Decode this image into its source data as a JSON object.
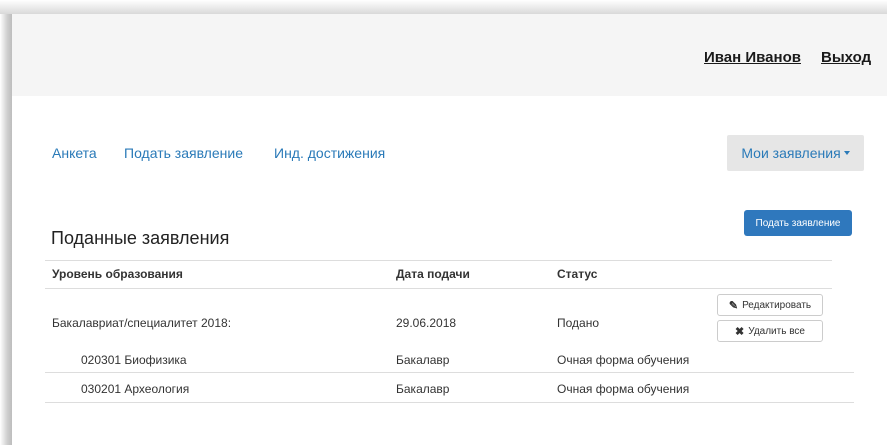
{
  "header": {
    "user_name": "Иван Иванов",
    "logout_label": "Выход"
  },
  "nav": {
    "items": [
      "Анкета",
      "Подать заявление",
      "Инд. достижения"
    ],
    "dropdown_label": "Мои заявления"
  },
  "page": {
    "submit_button": "Подать заявление",
    "section_title": "Поданные заявления"
  },
  "table": {
    "headers": [
      "Уровень образования",
      "Дата подачи",
      "Статус"
    ],
    "group": {
      "level": "Бакалавриат/специалитет 2018:",
      "date": "29.06.2018",
      "status": "Подано",
      "edit_label": "Редактировать",
      "delete_label": "Удалить все"
    },
    "rows": [
      {
        "program": "020301 Биофизика",
        "degree": "Бакалавр",
        "form": "Очная форма обучения"
      },
      {
        "program": "030201 Археология",
        "degree": "Бакалавр",
        "form": "Очная форма обучения"
      }
    ]
  },
  "icons": {
    "edit": "pencil-icon",
    "delete": "x-icon",
    "dropdown": "caret-down-icon"
  },
  "colors": {
    "link": "#2a7ab8",
    "primary": "#2f78bd",
    "topbar": "#f5f5f5"
  }
}
